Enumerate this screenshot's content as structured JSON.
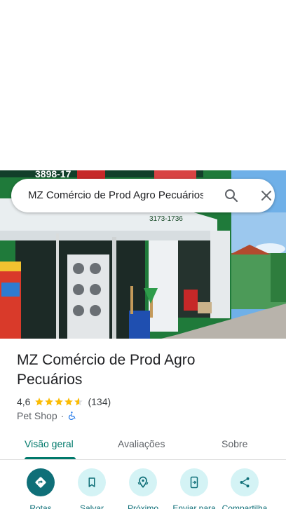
{
  "search": {
    "query": "MZ Comércio de Prod Agro Pecuários"
  },
  "place": {
    "name": "MZ Comércio de Prod Agro Pecuários",
    "rating": "4,6",
    "stars": 4.6,
    "review_count": "(134)",
    "category": "Pet Shop",
    "separator": "·"
  },
  "tabs": [
    {
      "label": "Visão geral",
      "active": true
    },
    {
      "label": "Avaliações",
      "active": false
    },
    {
      "label": "Sobre",
      "active": false
    }
  ],
  "actions": [
    {
      "label": "Rotas",
      "icon": "directions-icon"
    },
    {
      "label": "Salvar",
      "icon": "bookmark-icon"
    },
    {
      "label": "Próximo",
      "icon": "nearby-icon"
    },
    {
      "label": "Enviar para",
      "icon": "send-to-phone-icon"
    },
    {
      "label": "Compartilha",
      "icon": "share-icon"
    }
  ],
  "colors": {
    "accent": "#00796b",
    "action_bg": "#d4f3f5",
    "primary_action": "#0f6f78",
    "star": "#fbbc04"
  }
}
